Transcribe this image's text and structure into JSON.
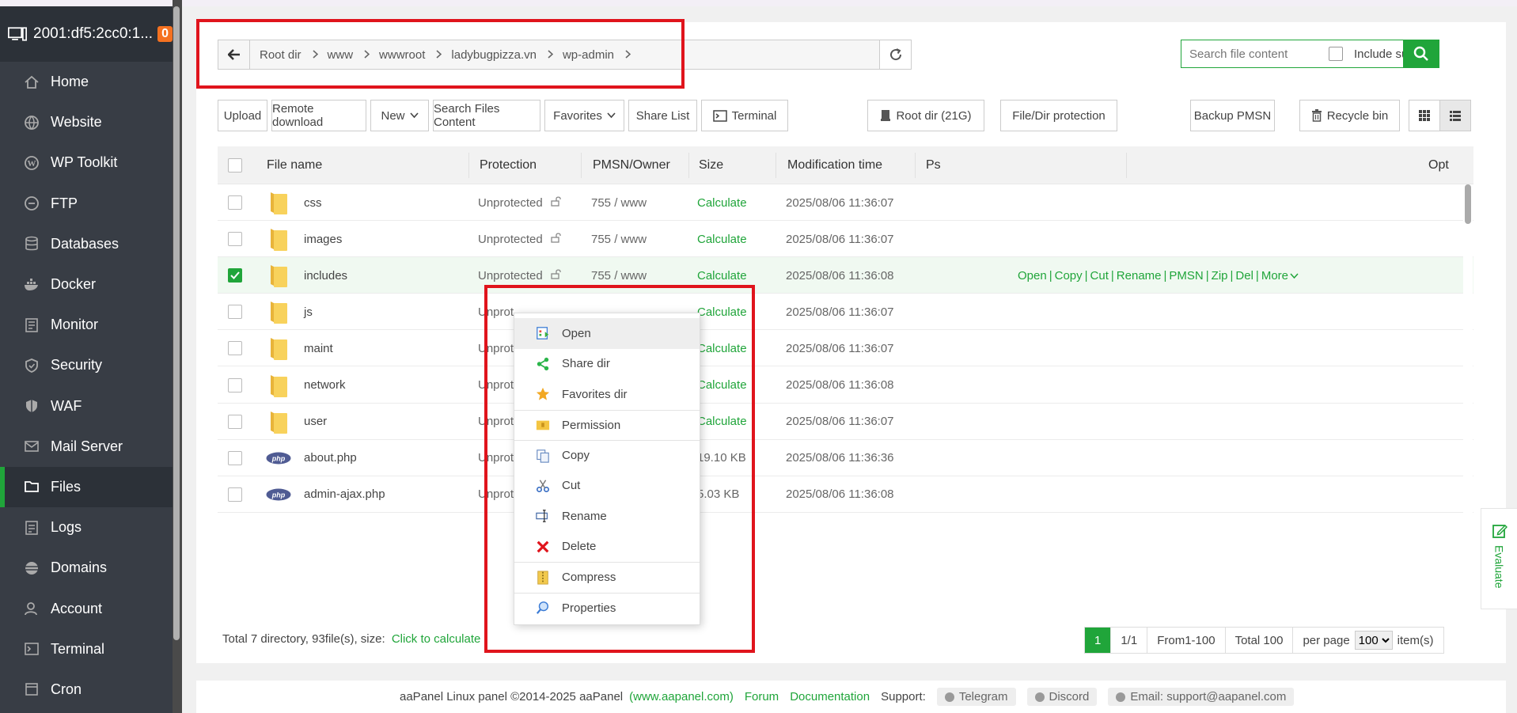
{
  "sidebar": {
    "host": "2001:df5:2cc0:1...",
    "badge": "0",
    "items": [
      {
        "label": "Home",
        "icon": "home-icon"
      },
      {
        "label": "Website",
        "icon": "globe-icon"
      },
      {
        "label": "WP Toolkit",
        "icon": "wordpress-icon"
      },
      {
        "label": "FTP",
        "icon": "ftp-icon"
      },
      {
        "label": "Databases",
        "icon": "database-icon"
      },
      {
        "label": "Docker",
        "icon": "docker-icon"
      },
      {
        "label": "Monitor",
        "icon": "monitor-icon"
      },
      {
        "label": "Security",
        "icon": "shield-icon"
      },
      {
        "label": "WAF",
        "icon": "waf-shield-icon"
      },
      {
        "label": "Mail Server",
        "icon": "mail-icon"
      },
      {
        "label": "Files",
        "icon": "folder-icon",
        "active": true
      },
      {
        "label": "Logs",
        "icon": "logs-icon"
      },
      {
        "label": "Domains",
        "icon": "domains-icon"
      },
      {
        "label": "Account",
        "icon": "user-icon"
      },
      {
        "label": "Terminal",
        "icon": "terminal-icon"
      },
      {
        "label": "Cron",
        "icon": "calendar-icon"
      }
    ]
  },
  "path": {
    "crumbs": [
      "Root dir",
      "www",
      "wwwroot",
      "ladybugpizza.vn",
      "wp-admin"
    ]
  },
  "search": {
    "placeholder": "Search file content",
    "include_subdir": "Include subdir"
  },
  "toolbar": {
    "upload": "Upload",
    "remote_download": "Remote download",
    "new": "New",
    "search_files_content": "Search Files Content",
    "favorites": "Favorites",
    "share_list": "Share List",
    "terminal": "Terminal",
    "root_dir": "Root dir (21G)",
    "protection": "File/Dir protection",
    "backup_pmsn": "Backup PMSN",
    "recycle_bin": "Recycle bin"
  },
  "table": {
    "headers": {
      "name": "File name",
      "protection": "Protection",
      "owner": "PMSN/Owner",
      "size": "Size",
      "mtime": "Modification time",
      "ps": "Ps",
      "opt": "Opt"
    },
    "rows": [
      {
        "name": "css",
        "type": "folder",
        "protection": "Unprotected",
        "owner": "755 / www",
        "size": "Calculate",
        "mtime": "2025/08/06 11:36:07"
      },
      {
        "name": "images",
        "type": "folder",
        "protection": "Unprotected",
        "owner": "755 / www",
        "size": "Calculate",
        "mtime": "2025/08/06 11:36:07"
      },
      {
        "name": "includes",
        "type": "folder",
        "protection": "Unprotected",
        "owner": "755 / www",
        "size": "Calculate",
        "mtime": "2025/08/06 11:36:08",
        "selected": true
      },
      {
        "name": "js",
        "type": "folder",
        "protection": "Unprot",
        "owner": "",
        "size": "Calculate",
        "mtime": "2025/08/06 11:36:07"
      },
      {
        "name": "maint",
        "type": "folder",
        "protection": "Unprot",
        "owner": "",
        "size": "Calculate",
        "mtime": "2025/08/06 11:36:07"
      },
      {
        "name": "network",
        "type": "folder",
        "protection": "Unprot",
        "owner": "",
        "size": "Calculate",
        "mtime": "2025/08/06 11:36:08"
      },
      {
        "name": "user",
        "type": "folder",
        "protection": "Unprot",
        "owner": "",
        "size": "Calculate",
        "mtime": "2025/08/06 11:36:07"
      },
      {
        "name": "about.php",
        "type": "php",
        "protection": "Unprot",
        "owner": "",
        "size": "19.10 KB",
        "mtime": "2025/08/06 11:36:36"
      },
      {
        "name": "admin-ajax.php",
        "type": "php",
        "protection": "Unprot",
        "owner": "",
        "size": "5.03 KB",
        "mtime": "2025/08/06 11:36:08"
      }
    ],
    "row_ops": [
      "Open",
      "Copy",
      "Cut",
      "Rename",
      "PMSN",
      "Zip",
      "Del",
      "More"
    ]
  },
  "context_menu": [
    {
      "label": "Open",
      "icon": "open-icon"
    },
    {
      "label": "Share dir",
      "icon": "share-icon"
    },
    {
      "label": "Favorites dir",
      "icon": "star-icon"
    },
    {
      "label": "Permission",
      "icon": "permission-icon"
    },
    {
      "label": "Copy",
      "icon": "copy-icon"
    },
    {
      "label": "Cut",
      "icon": "scissors-icon"
    },
    {
      "label": "Rename",
      "icon": "rename-icon"
    },
    {
      "label": "Delete",
      "icon": "delete-icon"
    },
    {
      "label": "Compress",
      "icon": "compress-icon"
    },
    {
      "label": "Properties",
      "icon": "properties-icon"
    }
  ],
  "footer": {
    "stats": "Total 7 directory, 93file(s), size:",
    "calc_link": "Click to calculate",
    "pager": {
      "current": "1",
      "pages": "1/1",
      "range": "From1-100",
      "total": "Total 100",
      "per_page_label": "per page",
      "per_page": "100",
      "items": "item(s)"
    }
  },
  "page_footer": {
    "copyright": "aaPanel Linux panel ©2014-2025 aaPanel",
    "site": "(www.aapanel.com)",
    "forum": "Forum",
    "docs": "Documentation",
    "support": "Support:",
    "telegram": "Telegram",
    "discord": "Discord",
    "email": "Email: support@aapanel.com"
  },
  "evaluate": "Evaluate",
  "colors": {
    "accent": "#20a53a",
    "sidebar": "#383d45",
    "annotation": "#e0141c"
  }
}
